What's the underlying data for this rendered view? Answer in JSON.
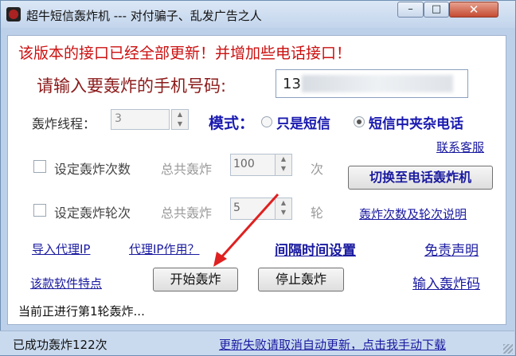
{
  "window": {
    "title": "超牛短信轰炸机 --- 对付骗子、乱发广告之人",
    "min_glyph": "–",
    "max_glyph": "□",
    "close_glyph": "✕"
  },
  "notice": "该版本的接口已经全部更新！并增加些电话接口！",
  "phone": {
    "label": "请输入要轰炸的手机号码:",
    "value": "13"
  },
  "threads": {
    "label": "轰炸线程：",
    "value": "3"
  },
  "mode": {
    "label": "模式：",
    "options": [
      {
        "label": "只是短信",
        "selected": false
      },
      {
        "label": "短信中夹杂电话",
        "selected": true
      }
    ]
  },
  "links": {
    "contact": "联系客服",
    "explain": "轰炸次数及轮次说明",
    "import_proxy": "导入代理IP",
    "proxy_use": "代理IP作用？",
    "interval": "间隔时间设置",
    "disclaimer": "免责声明",
    "features": "该款软件特点",
    "input_code": "输入轰炸码"
  },
  "count_row": {
    "checkbox_label": "设定轰炸次数",
    "total_label": "总共轰炸",
    "value": "100",
    "unit": "次"
  },
  "round_row": {
    "checkbox_label": "设定轰炸轮次",
    "total_label": "总共轰炸",
    "value": "5",
    "unit": "轮"
  },
  "buttons": {
    "switch_phone": "切换至电话轰炸机",
    "start": "开始轰炸",
    "stop": "停止轰炸"
  },
  "progress_text": "当前正进行第1轮轰炸...",
  "statusbar": {
    "success": "已成功轰炸122次",
    "update_link": "更新失败请取消自动更新，点击我手动下载"
  },
  "colors": {
    "accent": "#1a1aa0",
    "notice": "#cc1010",
    "arrow": "#e02020"
  }
}
